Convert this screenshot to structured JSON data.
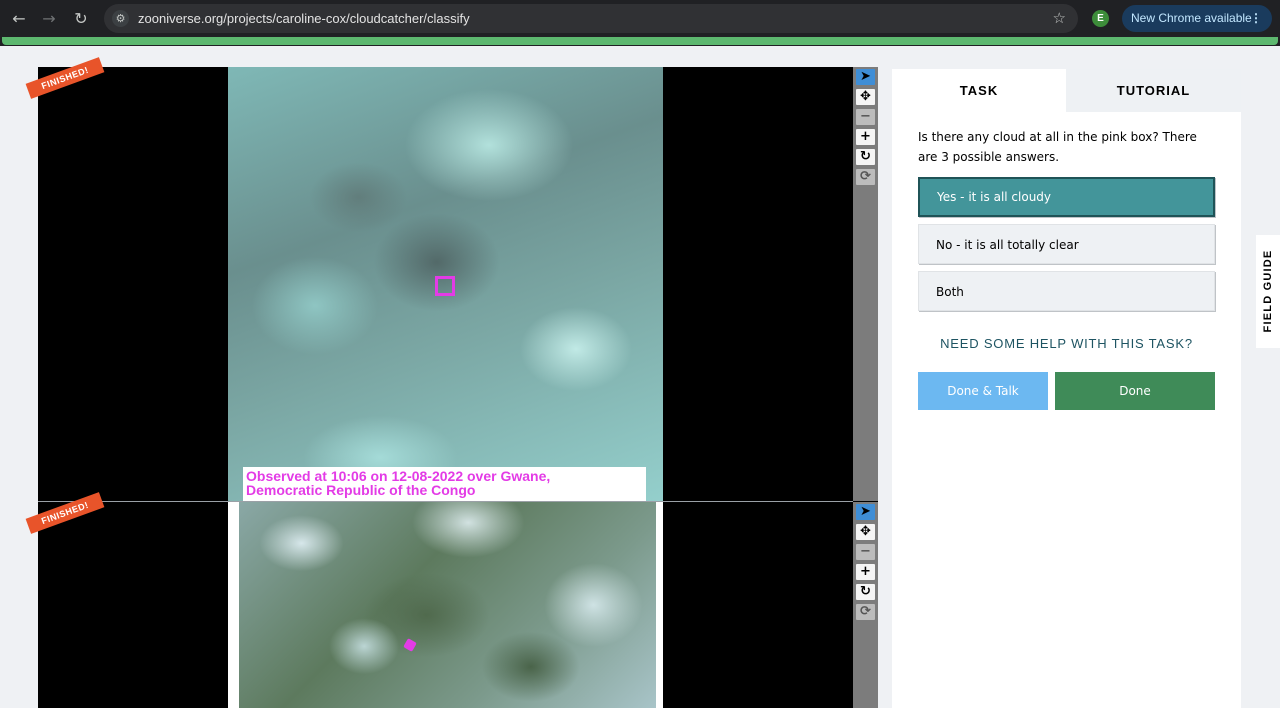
{
  "browser": {
    "url": "zooniverse.org/projects/caroline-cox/cloudcatcher/classify",
    "profile_initial": "E",
    "update_label": "New Chrome available",
    "back_icon": "←",
    "forward_icon": "→",
    "reload_icon": "↻",
    "site_info_icon": "⚙",
    "star_icon": "☆",
    "menu_icon": "⋮"
  },
  "viewer": {
    "top_ribbon": "FINISHED!",
    "bottom_ribbon": "FINISHED!",
    "caption_line1": "Observed at 10:06 on 12-08-2022 over Gwane,",
    "caption_line2": "Democratic Republic of the Congo",
    "tool_icons": {
      "pointer": "➤",
      "move": "✥",
      "zoom_out": "−",
      "zoom_in": "+",
      "rotate": "↻",
      "reset": "⟳"
    }
  },
  "panel": {
    "tab_task": "TASK",
    "tab_tutorial": "TUTORIAL",
    "question": "Is there any cloud at all in the pink box? There are 3 possible answers.",
    "answers": [
      "Yes - it is all cloudy",
      "No - it is all totally clear",
      "Both"
    ],
    "selected_answer_index": 0,
    "help_link": "NEED SOME HELP WITH THIS TASK?",
    "done_talk": "Done & Talk",
    "done": "Done"
  },
  "field_guide": "FIELD GUIDE",
  "colors": {
    "accent_selected": "#43959a",
    "done_green": "#3f8b58",
    "done_talk_blue": "#6cb8f1",
    "ribbon": "#e8542a",
    "pink_marker": "#e33be6"
  }
}
